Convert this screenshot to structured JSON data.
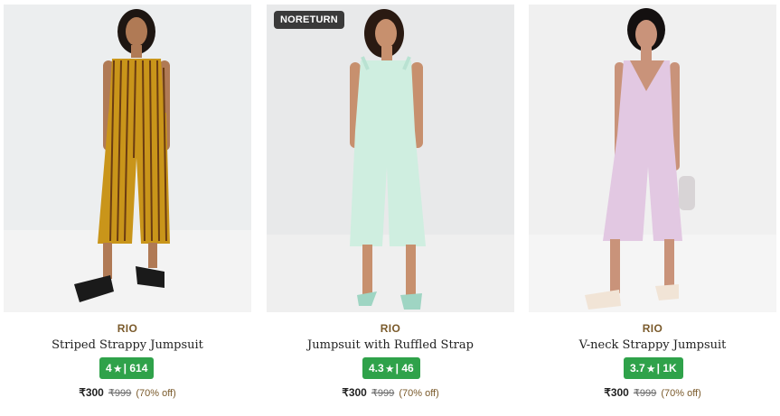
{
  "products": [
    {
      "tag": "",
      "brand": "RIO",
      "name": "Striped Strappy Jumpsuit",
      "rating": "4",
      "reviews": "614",
      "price": "₹300",
      "mrp": "₹999",
      "discount": "(70% off)",
      "image_colors": {
        "bg": "#eceeef",
        "floor": "#f3f3f3",
        "garment": "#c9951a",
        "stripe": "#6b3c12",
        "skin": "#b07a55",
        "hair": "#1e1612",
        "shoe": "#1a1a1a"
      }
    },
    {
      "tag": "NORETURN",
      "brand": "RIO",
      "name": "Jumpsuit with Ruffled Strap",
      "rating": "4.3",
      "reviews": "46",
      "price": "₹300",
      "mrp": "₹999",
      "discount": "(70% off)",
      "image_colors": {
        "bg": "#e8e9ea",
        "floor": "#efefef",
        "garment": "#cfeee0",
        "skin": "#c7906e",
        "hair": "#2a1a12",
        "shoe": "#9fd5c3"
      }
    },
    {
      "tag": "",
      "brand": "RIO",
      "name": "V-neck Strappy Jumpsuit",
      "rating": "3.7",
      "reviews": "1K",
      "price": "₹300",
      "mrp": "₹999",
      "discount": "(70% off)",
      "image_colors": {
        "bg": "#f0f0f0",
        "floor": "#f5f5f5",
        "garment": "#e2c8e2",
        "skin": "#c9937a",
        "hair": "#141010",
        "shoe": "#f1e4d6",
        "bag": "#d8d4d6"
      }
    }
  ],
  "rating_star_icon": "star-icon"
}
